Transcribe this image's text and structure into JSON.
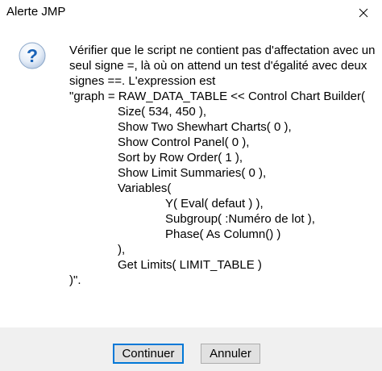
{
  "window": {
    "title": "Alerte JMP",
    "close_icon": "close-icon"
  },
  "icon": {
    "name": "question-icon",
    "glyph": "?",
    "color": "#1a63b8"
  },
  "message": {
    "lines": [
      "Vérifier que le script ne contient pas d'affectation avec un",
      "seul signe =, là où on attend un test d'égalité avec deux",
      "signes ==. L'expression est",
      "\"graph = RAW_DATA_TABLE << Control Chart Builder(",
      "Size( 534, 450 ),",
      "Show Two Shewhart Charts( 0 ),",
      "Show Control Panel( 0 ),",
      "Sort by Row Order( 1 ),",
      "Show Limit Summaries( 0 ),",
      "Variables(",
      "Y( Eval( defaut ) ),",
      "Subgroup( :Numéro de lot ),",
      "Phase( As Column() )",
      "),",
      "Get Limits( LIMIT_TABLE )",
      ")\"."
    ]
  },
  "buttons": {
    "continue_label": "Continuer",
    "cancel_label": "Annuler"
  },
  "colors": {
    "footer_bg": "#f0f0f0",
    "focus_border": "#0078d7"
  }
}
